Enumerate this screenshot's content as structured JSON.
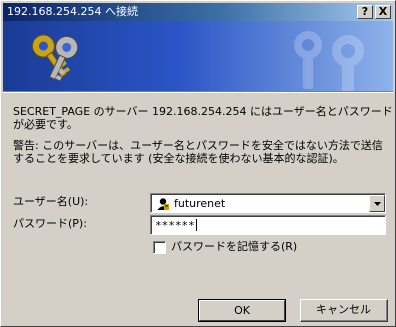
{
  "titlebar": {
    "title": "192.168.254.254 へ接続",
    "help_label": "?",
    "close_label": "X"
  },
  "message": {
    "line1": "SECRET_PAGE のサーバー 192.168.254.254 にはユーザー名とパスワード",
    "line2": "が必要です。",
    "warning_line1": "警告: このサーバーは、ユーザー名とパスワードを安全ではない方法で送信",
    "warning_line2": "することを要求しています (安全な接続を使わない基本的な認証)。"
  },
  "form": {
    "username_label": "ユーザー名(U):",
    "username_value": "futurenet",
    "password_label": "パスワード(P):",
    "password_value": "******",
    "remember_label": "パスワードを記憶する(R)",
    "remember_checked": false
  },
  "buttons": {
    "ok_label": "OK",
    "cancel_label": "キャンセル"
  },
  "colors": {
    "title_start": "#0a246a",
    "title_end": "#a6caf0",
    "banner": "#2b55c6",
    "face": "#d4d0c8"
  }
}
